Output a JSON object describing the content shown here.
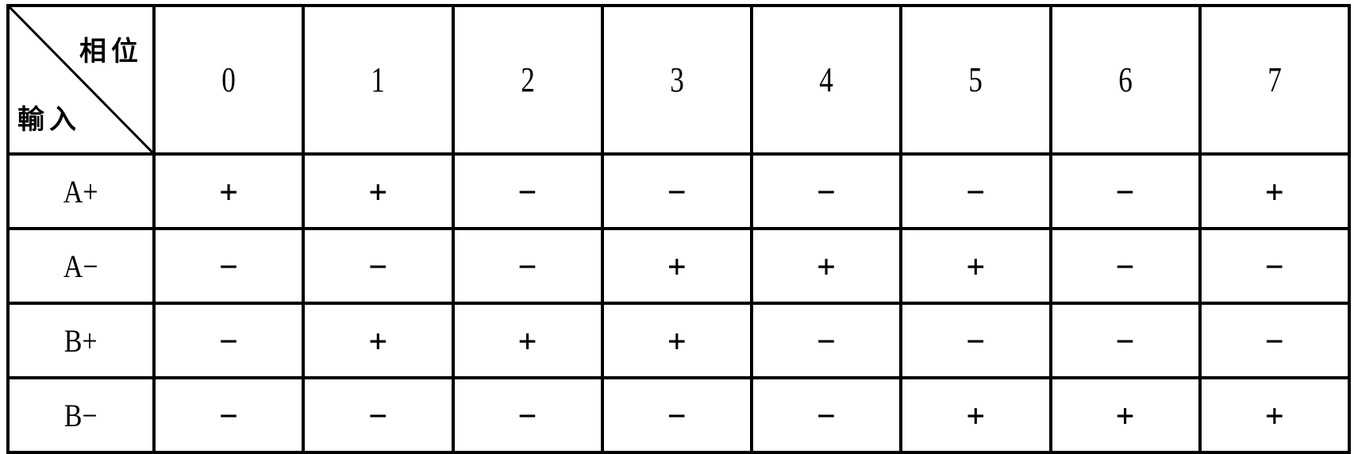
{
  "table": {
    "corner": {
      "top_label": "相位",
      "bottom_label": "輸入"
    },
    "phases": [
      "0",
      "1",
      "2",
      "3",
      "4",
      "5",
      "6",
      "7"
    ],
    "rows": [
      {
        "label": "A+",
        "values": [
          "+",
          "+",
          "−",
          "−",
          "−",
          "−",
          "−",
          "+"
        ]
      },
      {
        "label": "A−",
        "values": [
          "−",
          "−",
          "−",
          "+",
          "+",
          "+",
          "−",
          "−"
        ]
      },
      {
        "label": "B+",
        "values": [
          "−",
          "+",
          "+",
          "+",
          "−",
          "−",
          "−",
          "−"
        ]
      },
      {
        "label": "B−",
        "values": [
          "−",
          "−",
          "−",
          "−",
          "−",
          "+",
          "+",
          "+"
        ]
      }
    ]
  }
}
